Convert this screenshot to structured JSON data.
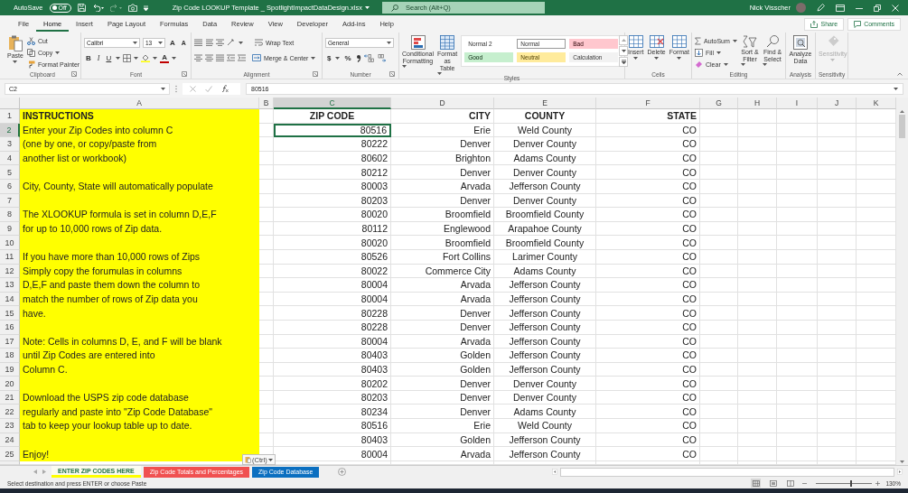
{
  "title_bar": {
    "autosave_label": "AutoSave",
    "autosave_toggle": {
      "label": "Off",
      "on": false
    },
    "title": "Zip Code LOOKUP Template _ SpotlightImpactDataDesign.xlsx",
    "search_placeholder": "Search (Alt+Q)",
    "user_name": "Nick Visscher"
  },
  "menu_tabs": [
    {
      "label": "File",
      "selected": false
    },
    {
      "label": "Home",
      "selected": true
    },
    {
      "label": "Insert",
      "selected": false
    },
    {
      "label": "Page Layout",
      "selected": false
    },
    {
      "label": "Formulas",
      "selected": false
    },
    {
      "label": "Data",
      "selected": false
    },
    {
      "label": "Review",
      "selected": false
    },
    {
      "label": "View",
      "selected": false
    },
    {
      "label": "Developer",
      "selected": false
    },
    {
      "label": "Add-ins",
      "selected": false
    },
    {
      "label": "Help",
      "selected": false
    }
  ],
  "share_button": "Share",
  "comments_button": "Comments",
  "ribbon": [
    {
      "kind": "clipboard",
      "name": "Clipboard",
      "labels": [
        "Paste",
        "Cut",
        "Copy",
        "Format Painter"
      ]
    },
    {
      "kind": "font",
      "name": "Font",
      "font_name": "Calibri",
      "font_size": "13",
      "grow": "A",
      "shrink": "A",
      "letters": [
        "B",
        "I",
        "U"
      ],
      "font_color": "A"
    },
    {
      "kind": "alignment",
      "name": "Alignment",
      "labels": [
        "Wrap Text",
        "Merge & Center"
      ]
    },
    {
      "kind": "number",
      "name": "Number",
      "format": "General",
      "symbols": [
        "$",
        "%"
      ]
    },
    {
      "kind": "styles",
      "name": "Styles",
      "labels": [
        "Conditional Formatting",
        "Format as Table"
      ],
      "gallery": [
        {
          "label": "Normal 2",
          "color": "#ffffff",
          "selected": false
        },
        {
          "label": "Normal",
          "color": "#ffffff",
          "selected": true
        },
        {
          "label": "Bad",
          "color": "#ffc7ce",
          "selected": false
        },
        {
          "label": "Good",
          "color": "#c6efce",
          "selected": false
        },
        {
          "label": "Neutral",
          "color": "#ffeb9c",
          "selected": false
        },
        {
          "label": "Calculation",
          "color": "#f2f2f2",
          "selected": false
        }
      ]
    },
    {
      "kind": "cells",
      "name": "Cells",
      "labels": [
        "Insert",
        "Delete",
        "Format"
      ]
    },
    {
      "kind": "editing",
      "name": "Editing",
      "labels": [
        "AutoSum",
        "Fill",
        "Clear",
        "Sort & Filter",
        "Find & Select"
      ]
    },
    {
      "kind": "analysis",
      "name": "Analysis",
      "labels": [
        "Analyze Data"
      ]
    },
    {
      "kind": "sensitivity",
      "name": "Sensitivity",
      "labels": [
        "Sensitivity"
      ],
      "disabled": true
    }
  ],
  "formula_bar": {
    "name_box": "C2",
    "value": "80516"
  },
  "columns": [
    {
      "letter": "A",
      "selected": false
    },
    {
      "letter": "B",
      "selected": false
    },
    {
      "letter": "C",
      "selected": true
    },
    {
      "letter": "D",
      "selected": false
    },
    {
      "letter": "E",
      "selected": false
    },
    {
      "letter": "F",
      "selected": false
    },
    {
      "letter": "G",
      "selected": false
    },
    {
      "letter": "H",
      "selected": false
    },
    {
      "letter": "I",
      "selected": false
    },
    {
      "letter": "J",
      "selected": false
    },
    {
      "letter": "K",
      "selected": false
    }
  ],
  "rows": [
    {
      "number": "1",
      "selected": false,
      "kind": "header",
      "instruction": "INSTRUCTIONS",
      "zip": "ZIP CODE",
      "city": "CITY",
      "county": "COUNTY",
      "state": "STATE"
    },
    {
      "number": "2",
      "selected": true,
      "kind": "data",
      "instruction": "Enter your Zip Codes into column C",
      "zip": "80516",
      "city": "Erie",
      "county": "Weld County",
      "state": "CO"
    },
    {
      "number": "3",
      "selected": false,
      "kind": "data",
      "instruction": "(one by one, or copy/paste from",
      "zip": "80222",
      "city": "Denver",
      "county": "Denver County",
      "state": "CO"
    },
    {
      "number": "4",
      "selected": false,
      "kind": "data",
      "instruction": "another list or workbook)",
      "zip": "80602",
      "city": "Brighton",
      "county": "Adams County",
      "state": "CO"
    },
    {
      "number": "5",
      "selected": false,
      "kind": "data",
      "zip": "80212",
      "city": "Denver",
      "county": "Denver County",
      "state": "CO"
    },
    {
      "number": "6",
      "selected": false,
      "kind": "data",
      "instruction": "City, County, State will automatically populate",
      "zip": "80003",
      "city": "Arvada",
      "county": "Jefferson County",
      "state": "CO"
    },
    {
      "number": "7",
      "selected": false,
      "kind": "data",
      "zip": "80203",
      "city": "Denver",
      "county": "Denver County",
      "state": "CO"
    },
    {
      "number": "8",
      "selected": false,
      "kind": "data",
      "instruction": "The XLOOKUP formula is set in column D,E,F",
      "zip": "80020",
      "city": "Broomfield",
      "county": "Broomfield County",
      "state": "CO"
    },
    {
      "number": "9",
      "selected": false,
      "kind": "data",
      "instruction": "for up to 10,000 rows of Zip data.",
      "zip": "80112",
      "city": "Englewood",
      "county": "Arapahoe County",
      "state": "CO"
    },
    {
      "number": "10",
      "selected": false,
      "kind": "data",
      "zip": "80020",
      "city": "Broomfield",
      "county": "Broomfield County",
      "state": "CO"
    },
    {
      "number": "11",
      "selected": false,
      "kind": "data",
      "instruction": "If you have more than 10,000 rows of Zips",
      "zip": "80526",
      "city": "Fort Collins",
      "county": "Larimer County",
      "state": "CO"
    },
    {
      "number": "12",
      "selected": false,
      "kind": "data",
      "instruction": "Simply copy the forumulas in columns",
      "zip": "80022",
      "city": "Commerce City",
      "county": "Adams County",
      "state": "CO"
    },
    {
      "number": "13",
      "selected": false,
      "kind": "data",
      "instruction": "D,E,F and paste them down the column to",
      "zip": "80004",
      "city": "Arvada",
      "county": "Jefferson County",
      "state": "CO"
    },
    {
      "number": "14",
      "selected": false,
      "kind": "data",
      "instruction": "match the number of rows of Zip data you",
      "zip": "80004",
      "city": "Arvada",
      "county": "Jefferson County",
      "state": "CO"
    },
    {
      "number": "15",
      "selected": false,
      "kind": "data",
      "instruction": "have.",
      "zip": "80228",
      "city": "Denver",
      "county": "Jefferson County",
      "state": "CO"
    },
    {
      "number": "16",
      "selected": false,
      "kind": "data",
      "zip": "80228",
      "city": "Denver",
      "county": "Jefferson County",
      "state": "CO"
    },
    {
      "number": "17",
      "selected": false,
      "kind": "data",
      "instruction": "Note: Cells in columns D, E, and F will be blank",
      "zip": "80004",
      "city": "Arvada",
      "county": "Jefferson County",
      "state": "CO"
    },
    {
      "number": "18",
      "selected": false,
      "kind": "data",
      "instruction": "until Zip Codes are entered into",
      "zip": "80403",
      "city": "Golden",
      "county": "Jefferson County",
      "state": "CO"
    },
    {
      "number": "19",
      "selected": false,
      "kind": "data",
      "instruction": "Column C.",
      "zip": "80403",
      "city": "Golden",
      "county": "Jefferson County",
      "state": "CO"
    },
    {
      "number": "20",
      "selected": false,
      "kind": "data",
      "zip": "80202",
      "city": "Denver",
      "county": "Denver County",
      "state": "CO"
    },
    {
      "number": "21",
      "selected": false,
      "kind": "data",
      "instruction": "Download the USPS zip code database",
      "zip": "80203",
      "city": "Denver",
      "county": "Denver County",
      "state": "CO"
    },
    {
      "number": "22",
      "selected": false,
      "kind": "data",
      "instruction": "regularly and paste into \"Zip Code Database\"",
      "zip": "80234",
      "city": "Denver",
      "county": "Adams County",
      "state": "CO"
    },
    {
      "number": "23",
      "selected": false,
      "kind": "data",
      "instruction": "tab to keep your lookup table up to date.",
      "zip": "80516",
      "city": "Erie",
      "county": "Weld County",
      "state": "CO"
    },
    {
      "number": "24",
      "selected": false,
      "kind": "data",
      "zip": "80403",
      "city": "Golden",
      "county": "Jefferson County",
      "state": "CO"
    },
    {
      "number": "25",
      "selected": false,
      "kind": "data",
      "instruction": "Enjoy!",
      "zip": "80004",
      "city": "Arvada",
      "county": "Jefferson County",
      "state": "CO"
    }
  ],
  "paste_options": "(Ctrl)",
  "sheet_tabs": [
    {
      "label": "ENTER  ZIP CODES HERE",
      "selected": true,
      "color": "#ffff00"
    },
    {
      "label": "Zip Code Totals and Percentages",
      "selected": false,
      "color": "#f05050"
    },
    {
      "label": "Zip Code Database",
      "selected": false,
      "color": "#0b6fc0"
    }
  ],
  "status_bar": {
    "message": "Select destination and press ENTER or choose Paste",
    "views": [
      {
        "selected": true
      },
      {
        "selected": false
      },
      {
        "selected": false
      }
    ],
    "zoom": {
      "level": 0.6
    },
    "zoom_label": "130%"
  }
}
